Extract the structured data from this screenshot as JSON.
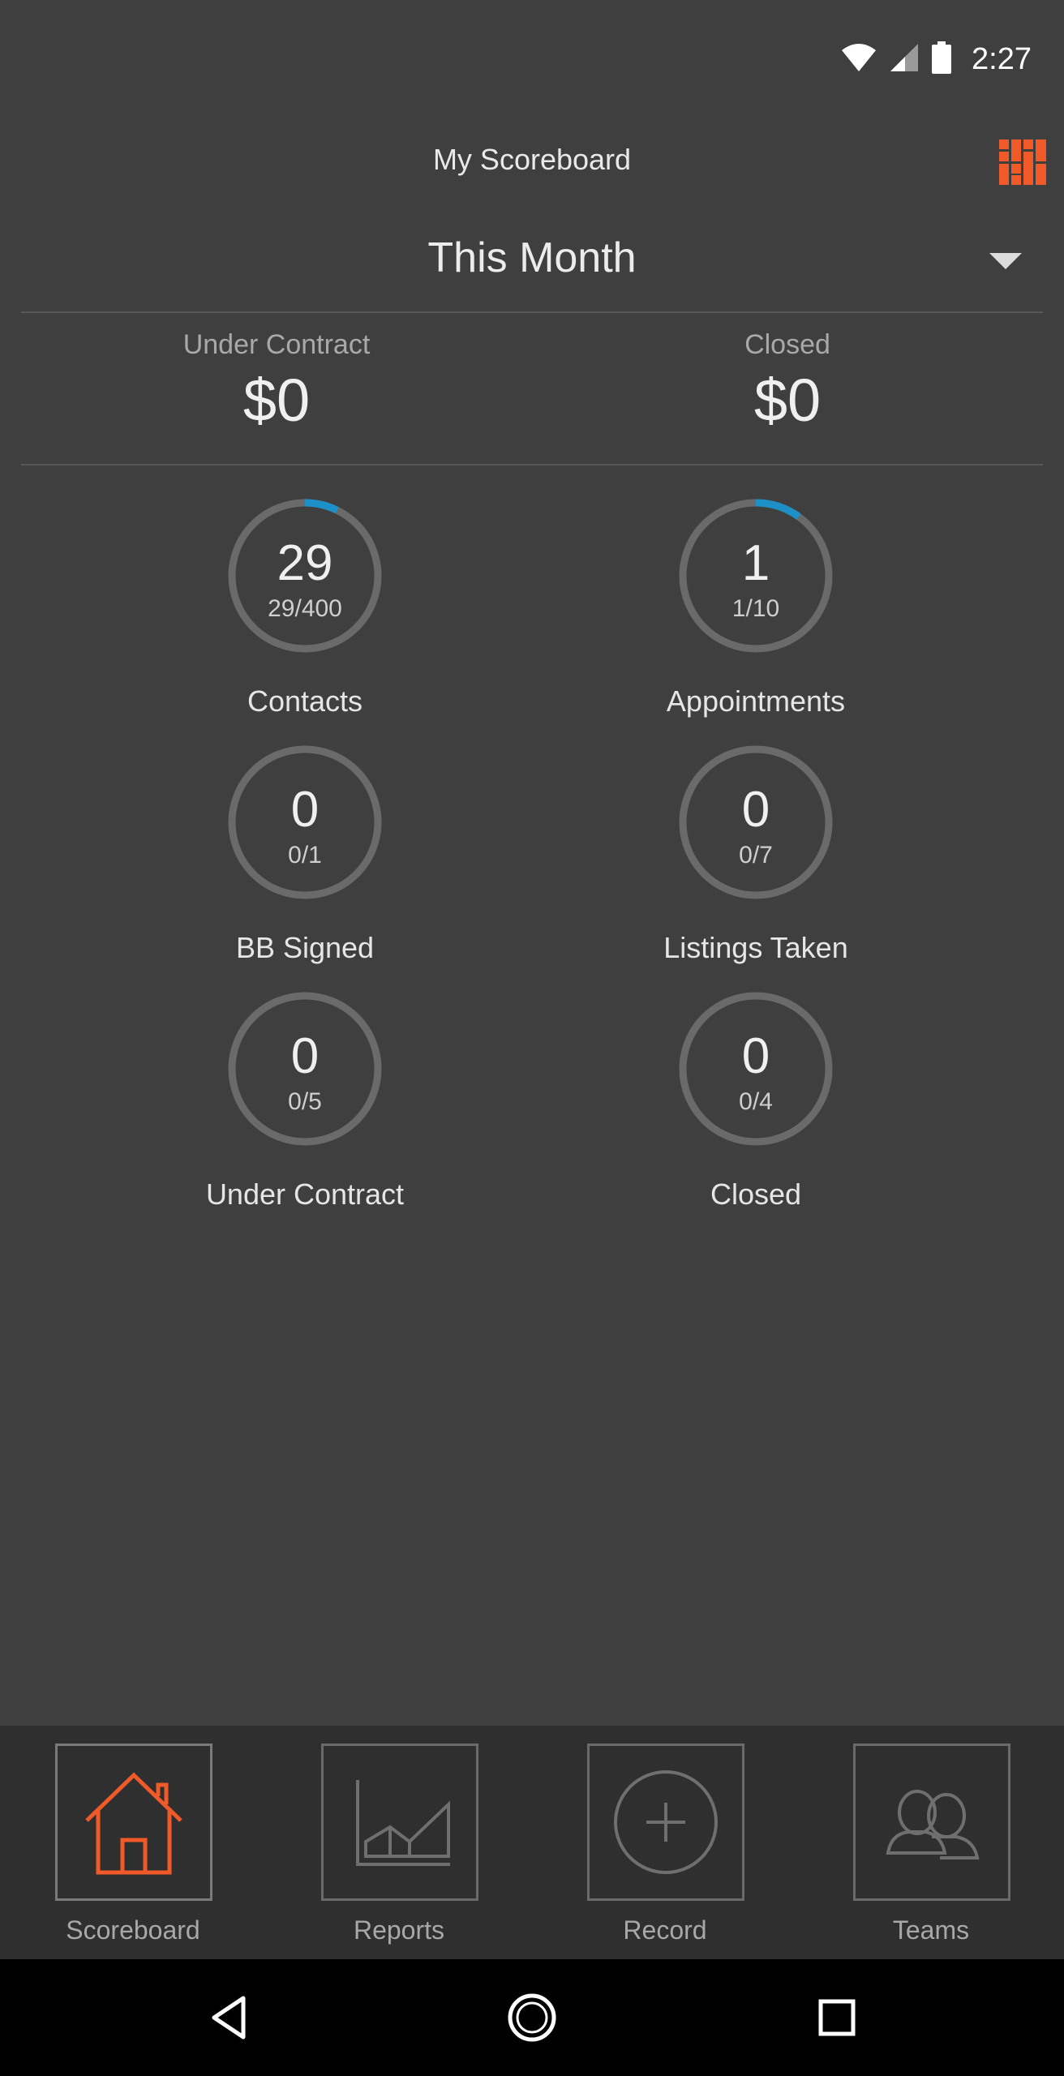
{
  "status_bar": {
    "time": "2:27",
    "icons": [
      "wifi-icon",
      "signal-icon",
      "battery-icon"
    ]
  },
  "header": {
    "title": "My Scoreboard",
    "grid_icon": "grid-icon"
  },
  "period": {
    "label": "This Month"
  },
  "totals": [
    {
      "label": "Under Contract",
      "value": "$0"
    },
    {
      "label": "Closed",
      "value": "$0"
    }
  ],
  "metrics": [
    {
      "value": "29",
      "sub": "29/400",
      "label": "Contacts",
      "progress": 0.0725
    },
    {
      "value": "1",
      "sub": "1/10",
      "label": "Appointments",
      "progress": 0.1
    },
    {
      "value": "0",
      "sub": "0/1",
      "label": "BB Signed",
      "progress": 0
    },
    {
      "value": "0",
      "sub": "0/7",
      "label": "Listings Taken",
      "progress": 0
    },
    {
      "value": "0",
      "sub": "0/5",
      "label": "Under Contract",
      "progress": 0
    },
    {
      "value": "0",
      "sub": "0/4",
      "label": "Closed",
      "progress": 0
    }
  ],
  "bottom_nav": [
    {
      "label": "Scoreboard",
      "icon": "home-icon",
      "active": true
    },
    {
      "label": "Reports",
      "icon": "chart-icon",
      "active": false
    },
    {
      "label": "Record",
      "icon": "plus-circle-icon",
      "active": false
    },
    {
      "label": "Teams",
      "icon": "people-icon",
      "active": false
    }
  ],
  "colors": {
    "accent": "#f05a28",
    "progress": "#1e90c8",
    "ring_track": "#6a6a6a",
    "background": "#3f3f3f"
  }
}
